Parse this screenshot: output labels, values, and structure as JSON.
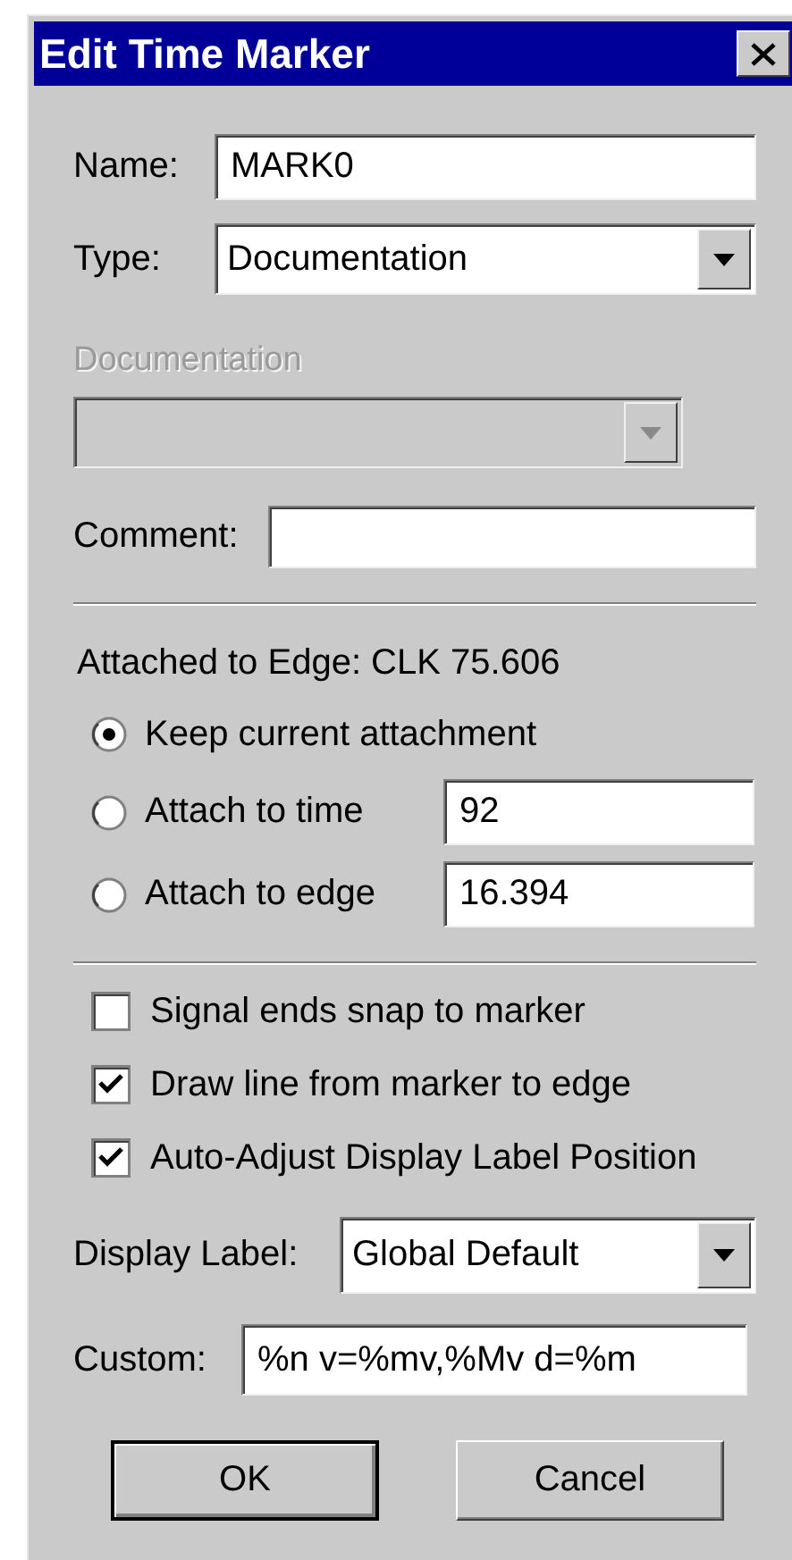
{
  "window": {
    "title": "Edit Time Marker"
  },
  "name": {
    "label": "Name:",
    "value": "MARK0"
  },
  "type": {
    "label": "Type:",
    "value": "Documentation"
  },
  "documentation": {
    "label": "Documentation",
    "disabled": true
  },
  "comment": {
    "label": "Comment:"
  },
  "attachment": {
    "heading": "Attached to Edge: CLK 75.606",
    "options": [
      {
        "label": "Keep current attachment",
        "selected": true
      },
      {
        "label": "Attach to time",
        "selected": false,
        "value": "92"
      },
      {
        "label": "Attach to edge",
        "selected": false,
        "value": "16.394"
      }
    ]
  },
  "options": [
    {
      "label": "Signal ends snap to marker",
      "checked": false
    },
    {
      "label": "Draw line from marker to edge",
      "checked": true
    },
    {
      "label": "Auto-Adjust Display Label Position",
      "checked": true
    }
  ],
  "display_label": {
    "label": "Display Label:",
    "value": "Global Default"
  },
  "custom": {
    "label": "Custom:",
    "value": "%n v=%mv,%Mv d=%m"
  },
  "buttons": [
    {
      "label": "OK",
      "default": true
    },
    {
      "label": "Cancel",
      "default": false
    }
  ]
}
